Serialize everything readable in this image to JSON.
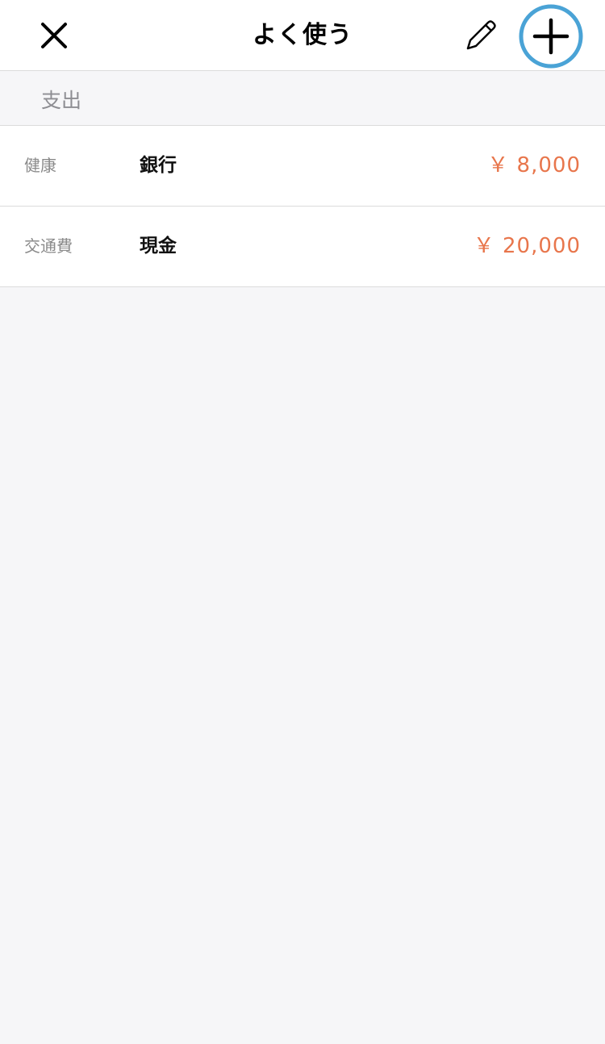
{
  "nav": {
    "title": "よく使う",
    "close_icon": "close-icon",
    "edit_icon": "pencil-icon",
    "add_icon": "plus-icon",
    "highlight_color": "#4aa3d6"
  },
  "section": {
    "label": "支出"
  },
  "items": [
    {
      "category": "健康",
      "account": "銀行",
      "amount": "￥ 8,000"
    },
    {
      "category": "交通費",
      "account": "現金",
      "amount": "￥ 20,000"
    }
  ],
  "colors": {
    "amount": "#e8764c",
    "background": "#f6f6f8"
  }
}
